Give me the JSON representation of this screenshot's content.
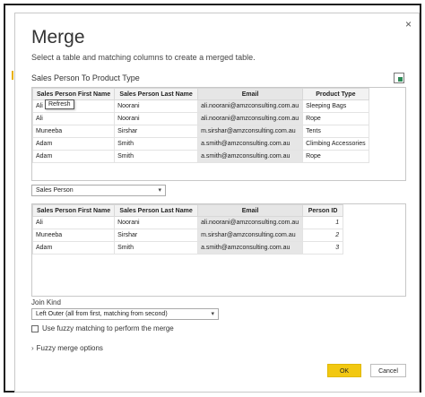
{
  "dialog": {
    "title": "Merge",
    "subtitle": "Select a table and matching columns to create a merged table.",
    "close_glyph": "×"
  },
  "top_table": {
    "label": "Sales Person To Product Type",
    "tooltip": "Refresh",
    "columns": [
      "Sales Person First Name",
      "Sales Person Last Name",
      "Email",
      "Product Type"
    ],
    "rows": [
      [
        "Ali",
        "Noorani",
        "ali.noorani@amzconsulting.com.au",
        "Sleeping Bags"
      ],
      [
        "Ali",
        "Noorani",
        "ali.noorani@amzconsulting.com.au",
        "Rope"
      ],
      [
        "Muneeba",
        "Sirshar",
        "m.sirshar@amzconsulting.com.au",
        "Tents"
      ],
      [
        "Adam",
        "Smith",
        "a.smith@amzconsulting.com.au",
        "Climbing Accessories"
      ],
      [
        "Adam",
        "Smith",
        "a.smith@amzconsulting.com.au",
        "Rope"
      ]
    ],
    "selected_column": 2
  },
  "second_select": {
    "value": "Sales Person",
    "caret_icon": "chevron-down-icon"
  },
  "bottom_table": {
    "columns": [
      "Sales Person First Name",
      "Sales Person Last Name",
      "Email",
      "Person ID"
    ],
    "rows": [
      [
        "Ali",
        "Noorani",
        "ali.noorani@amzconsulting.com.au",
        "1"
      ],
      [
        "Muneeba",
        "Sirshar",
        "m.sirshar@amzconsulting.com.au",
        "2"
      ],
      [
        "Adam",
        "Smith",
        "a.smith@amzconsulting.com.au",
        "3"
      ]
    ],
    "selected_column": 2
  },
  "join": {
    "label": "Join Kind",
    "value": "Left Outer (all from first, matching from second)",
    "fuzzy_checkbox_label": "Use fuzzy matching to perform the merge",
    "fuzzy_checked": false,
    "fuzzy_options_label": "Fuzzy merge options"
  },
  "buttons": {
    "ok": "OK",
    "cancel": "Cancel"
  },
  "colors": {
    "ok_button": "#f2c811",
    "selected_column": "#e6e6e6"
  }
}
